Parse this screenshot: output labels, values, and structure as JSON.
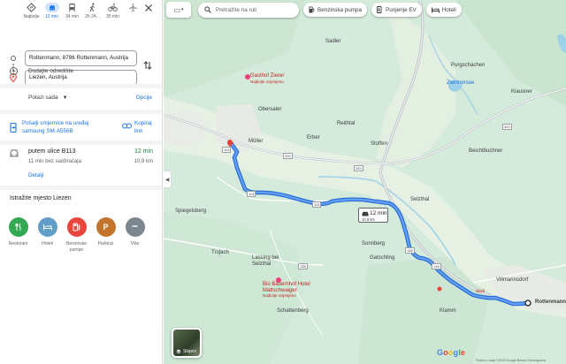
{
  "travel_modes": [
    {
      "name": "best",
      "label": "Najbolje",
      "icon": "directions-icon"
    },
    {
      "name": "car",
      "label": "12 min",
      "icon": "car-icon",
      "active": true
    },
    {
      "name": "transit",
      "label": "34 min",
      "icon": "transit-icon"
    },
    {
      "name": "walk",
      "label": "2h 24...",
      "icon": "walk-icon"
    },
    {
      "name": "bike",
      "label": "35 min",
      "icon": "bike-icon"
    },
    {
      "name": "flight",
      "label": "",
      "icon": "flight-icon"
    }
  ],
  "origin": "Rottenmann, 8786 Rottenmann, Austrija",
  "destination": "Liezen, Austrija",
  "add_destination": "Dodajte odredište",
  "depart": {
    "label": "Polazi sada",
    "options": "Opcije"
  },
  "send_to_device": {
    "label": "Pošalji smjernice na uređaj samsung SM-A556B",
    "copy_link": "Kopiraj link"
  },
  "route": {
    "via": "putem ulice B113",
    "duration": "12 min",
    "traffic_note": "11 min bez saobraćaja",
    "distance": "10,9 km",
    "details": "Detalji"
  },
  "explore": {
    "title": "Istražite mjesto Liezen",
    "categories": [
      {
        "label": "Restorani",
        "icon": "fork-knife-icon",
        "color": "#34a853",
        "glyph": "🍴"
      },
      {
        "label": "Hoteli",
        "icon": "bed-icon",
        "color": "#5f9fc7",
        "glyph": "▬"
      },
      {
        "label": "Benzinske pumpe",
        "icon": "gas-pump-icon",
        "color": "#e8453c",
        "glyph": "⛽"
      },
      {
        "label": "Parkinzi",
        "icon": "parking-icon",
        "color": "#c2732c",
        "glyph": "P"
      },
      {
        "label": "Više",
        "icon": "more-icon",
        "color": "#7c8690",
        "glyph": "•••"
      }
    ]
  },
  "map": {
    "search_placeholder": "Pretražite na ruti",
    "chips": [
      {
        "label": "Benzinska pumpa",
        "icon": "gas-pump-icon"
      },
      {
        "label": "Punjenje EV",
        "icon": "ev-charging-icon"
      },
      {
        "label": "Hoteli",
        "icon": "bed-icon"
      }
    ],
    "route_bubble": {
      "duration": "12 min",
      "distance": "10,9 km"
    },
    "layers_label": "Slojevi",
    "places": {
      "sadler": "Sadler",
      "purgschachen": "Purgschachen",
      "zwirtnersee": "Zwirtnersee",
      "klausner": "Klausner",
      "obersaler": "Obersaler",
      "reithtal": "Reithtal",
      "muller": "Müller",
      "erber": "Erber",
      "stoffen": "Stoffen",
      "beichtbuchner": "Beichtbuchner",
      "spiegelsberg": "Spiegelsberg",
      "selzthal": "Selzthal",
      "sonnberg": "Sonnberg",
      "trojach": "Trojach",
      "lassing_bei_selzthal": "Lassing bei Selzthal",
      "gatschling": "Gatschling",
      "villmannsdorf": "Villmannsdorf",
      "schattenberg": "Schattenberg",
      "klamm": "Klamm",
      "rottenmann": "Rottenmann",
      "shell": "Shell"
    },
    "pois": {
      "gasthof": {
        "name": "Gasthof Zierer",
        "note": "Najbolje ocijenjeno"
      },
      "bauernhof": {
        "name": "Bio Bauernhof Hotel Mattschwaiger",
        "note": "Najbolje ocijenjeno"
      }
    },
    "shields": [
      "320",
      "320",
      "113",
      "113",
      "138",
      "320",
      "146",
      "146",
      "113"
    ],
    "google": "Google",
    "footer": "Podaci o mapi ©2025 Google   Bosna i Hercegovina"
  }
}
